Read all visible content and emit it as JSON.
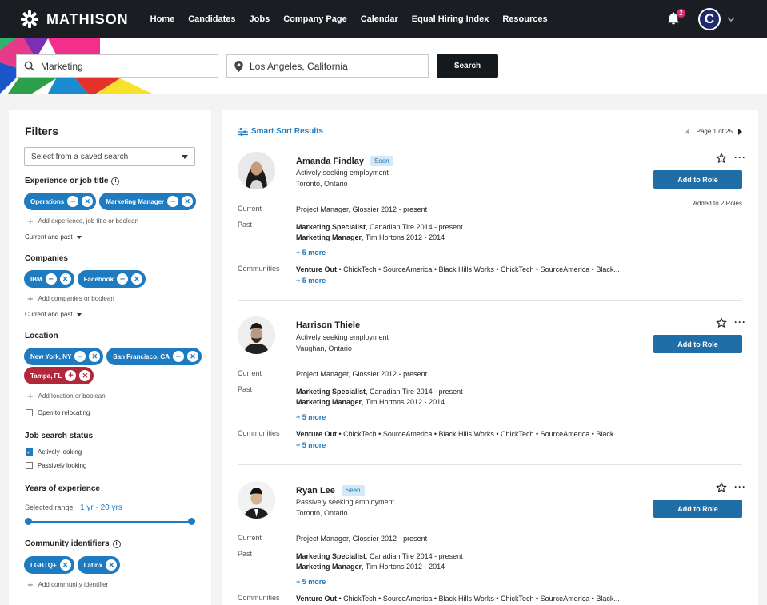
{
  "nav": {
    "brand": "MATHISON",
    "links": [
      "Home",
      "Candidates",
      "Jobs",
      "Company Page",
      "Calendar",
      "Equal Hiring Index",
      "Resources"
    ],
    "notifications": "2",
    "avatar_letter": "C"
  },
  "search": {
    "keyword": "Marketing",
    "location": "Los Angeles, California",
    "button": "Search"
  },
  "filters": {
    "title": "Filters",
    "saved_search": "Select from a saved search",
    "experience": {
      "title": "Experience or job title",
      "chips": [
        "Operations",
        "Marketing Manager"
      ],
      "add": "Add experience, job title or boolean",
      "scope": "Current and past"
    },
    "companies": {
      "title": "Companies",
      "chips": [
        "IBM",
        "Facebook"
      ],
      "add": "Add companies or boolean",
      "scope": "Current and past"
    },
    "location": {
      "title": "Location",
      "chips": [
        "New York, NY",
        "San Francisco, CA",
        "Tampa, FL"
      ],
      "add": "Add location or boolean",
      "relocate": "Open to relocating"
    },
    "job_status": {
      "title": "Job search status",
      "active": "Actively looking",
      "passive": "Passively looking"
    },
    "years": {
      "title": "Years of experience",
      "label": "Selected range",
      "value": "1 yr - 20 yrs",
      "min_fraction": 0,
      "max_fraction": 1
    },
    "community": {
      "title": "Community identifiers",
      "chips": [
        "LGBTQ+",
        "Latinx"
      ],
      "add": "Add community identifier"
    }
  },
  "results": {
    "sort": "Smart Sort Results",
    "page": "Page 1 of 25",
    "add_role": "Add to Role",
    "current_label": "Current",
    "past_label": "Past",
    "communities_label": "Communities",
    "more": "+ 5 more",
    "candidates": [
      {
        "name": "Amanda Findlay",
        "seen": "Seen",
        "status": "Actively seeking employment",
        "location": "Toronto, Ontario",
        "current": "Project Manager, Glossier 2012 - present",
        "past1_title": "Marketing Specialist",
        "past1_rest": ", Canadian Tire 2014 - present",
        "past2_title": "Marketing Manager",
        "past2_rest": ", Tim Hortons 2012 - 2014",
        "comm_first": "Venture Out",
        "comm_rest": " • ChickTech • SourceAmerica • Black Hills Works  • ChickTech • SourceAmerica • Black...",
        "added": "Added to 2 Roles"
      },
      {
        "name": "Harrison Thiele",
        "seen": "",
        "status": "Actively seeking employment",
        "location": "Vaughan, Ontario",
        "current": "Project Manager, Glossier 2012 - present",
        "past1_title": "Marketing Specialist",
        "past1_rest": ", Canadian Tire 2014 - present",
        "past2_title": "Marketing Manager",
        "past2_rest": ", Tim Hortons 2012 - 2014",
        "comm_first": "Venture Out",
        "comm_rest": " • ChickTech • SourceAmerica • Black Hills Works  • ChickTech • SourceAmerica • Black...",
        "added": ""
      },
      {
        "name": "Ryan Lee",
        "seen": "Seen",
        "status": "Passively seeking employment",
        "location": "Toronto, Ontario",
        "current": "Project Manager, Glossier 2012 - present",
        "past1_title": "Marketing Specialist",
        "past1_rest": ", Canadian Tire 2014 - present",
        "past2_title": "Marketing Manager",
        "past2_rest": ", Tim Hortons 2012 - 2014",
        "comm_first": "Venture Out",
        "comm_rest": " • ChickTech • SourceAmerica • Black Hills Works  • ChickTech • SourceAmerica • Black...",
        "added": ""
      }
    ]
  },
  "colors": {
    "nav_bg": "#1a1e22",
    "accent": "#1f7bbf",
    "button": "#1f6ea8",
    "chip_red": "#b0283a"
  }
}
